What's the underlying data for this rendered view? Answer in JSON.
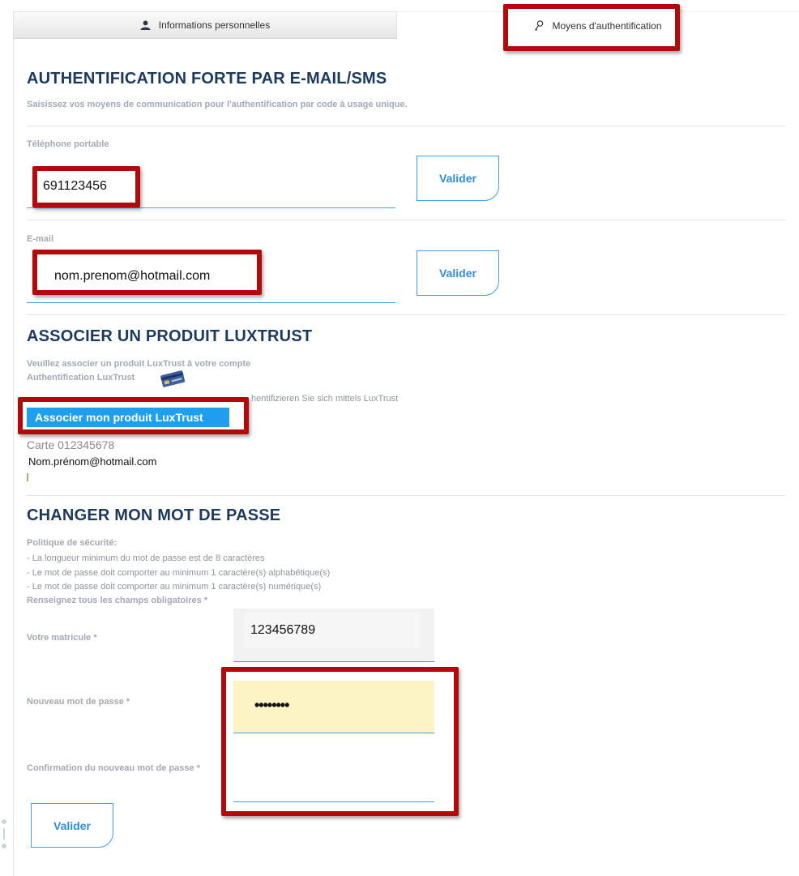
{
  "tabs": [
    {
      "label": "Informations personnelles",
      "icon": "user-icon",
      "active": false
    },
    {
      "label": "Moyens d'authentification",
      "icon": "key-icon",
      "active": true
    }
  ],
  "auth_section": {
    "title": "AUTHENTIFICATION FORTE PAR E-MAIL/SMS",
    "subtitle": "Saisissez vos moyens de communication pour l'authentification par code à usage unique.",
    "phone": {
      "label": "Téléphone portable",
      "value": "691123456",
      "button": "Valider"
    },
    "email": {
      "label": "E-mail",
      "value": "nom.prenom@hotmail.com",
      "button": "Valider"
    }
  },
  "luxtrust_section": {
    "title": "ASSOCIER UN PRODUIT LUXTRUST",
    "line1": "Veuillez associer un produit LuxTrust à votre compte",
    "line2": "Authentification LuxTrust",
    "line3_partial": "hentifizieren Sie sich mittels LuxTrust",
    "button": "Associer mon produit LuxTrust",
    "card": "Carte 012345678",
    "email": "Nom.prénom@hotmail.com"
  },
  "password_section": {
    "title": "CHANGER MON MOT DE PASSE",
    "policy_title": "Politique de sécurité:",
    "rules": [
      "- La longueur minimum du mot de passe est de 8 caractères",
      "- Le mot de passe doit comporter au minimum 1 caractère(s) alphabétique(s)",
      "- Le mot de passe doit comporter au minimum 1 caractère(s) numérique(s)"
    ],
    "required_note": "Renseignez tous les champs obligatoires *",
    "matricule": {
      "label": "Votre matricule *",
      "value": "123456789"
    },
    "new_password": {
      "label": "Nouveau mot de passe *",
      "value": "••••••••"
    },
    "confirm_password": {
      "label": "Confirmation du nouveau mot de passe *",
      "value": ""
    },
    "button": "Valider"
  },
  "colors": {
    "accent": "#3aa0ef",
    "title": "#1c3a5e",
    "highlight": "#b5080a",
    "autofill": "#fcf4c4"
  }
}
